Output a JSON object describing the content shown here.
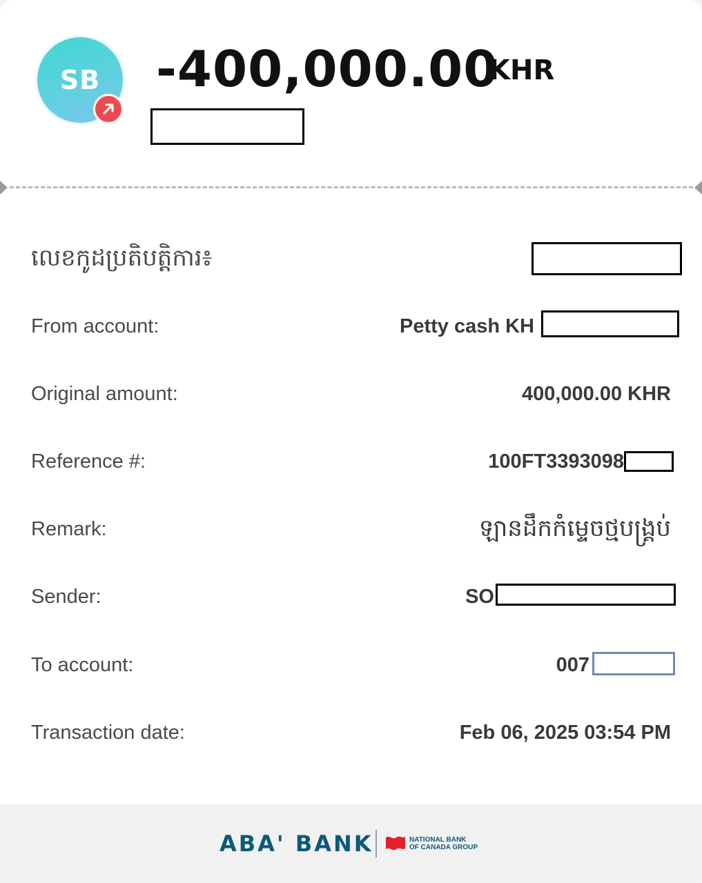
{
  "header": {
    "avatar_initials": "SB",
    "amount": "-400,000.00",
    "currency": "KHR",
    "colors": {
      "avatar_gradient_start": "#3fd8cf",
      "avatar_gradient_end": "#7cc7ee",
      "badge": "#ef4a51"
    },
    "badge_icon": "arrow-up-right-icon"
  },
  "details": {
    "transaction_id_label": "លេខកូដប្រតិបត្តិការ៖",
    "from_account_label": "From account:",
    "from_account_value": "Petty cash KH",
    "original_amount_label": "Original amount:",
    "original_amount_value": "400,000.00 KHR",
    "reference_label": "Reference #:",
    "reference_value": "100FT3393098",
    "remark_label": "Remark:",
    "remark_value": "ឡានដឹកកំម្ទេចថ្មបង្គ្រប់",
    "sender_label": "Sender:",
    "sender_value": "SO",
    "to_account_label": "To account:",
    "to_account_value": "007",
    "date_label": "Transaction date:",
    "date_value": "Feb 06, 2025 03:54 PM"
  },
  "footer": {
    "bank_name": "ABA' BANK",
    "partner_line1": "NATIONAL BANK",
    "partner_line2": "OF CANADA GROUP",
    "brand_color": "#0c5a79",
    "partner_logo_color": "#e4202a"
  }
}
